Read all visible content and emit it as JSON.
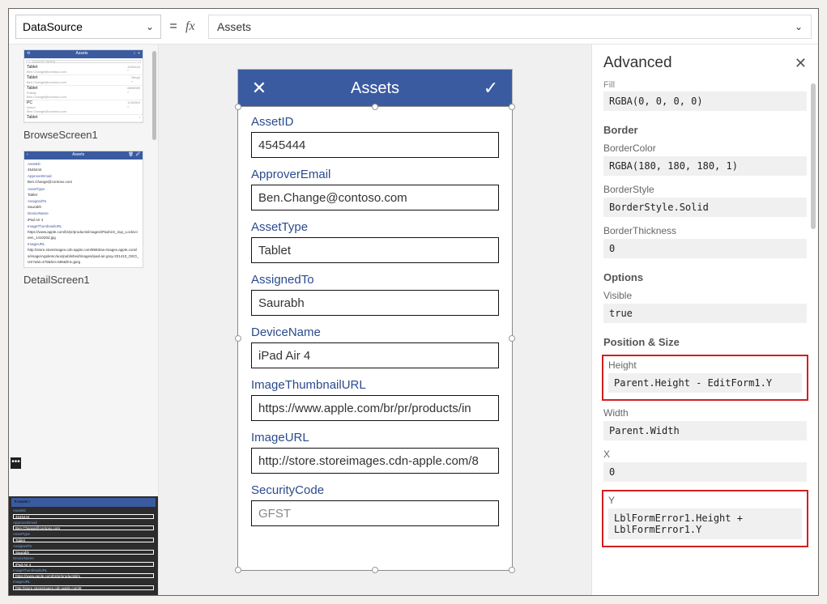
{
  "formulaBar": {
    "property": "DataSource",
    "formula": "Assets"
  },
  "tree": {
    "screen1Caption": "BrowseScreen1",
    "screen2Caption": "DetailScreen1",
    "browseHeader": "Assets",
    "rows": [
      {
        "title": "Tablet",
        "sub": "Ben.Change@contoso.com",
        "meta": "4545444"
      },
      {
        "title": "Tablet",
        "sub": "Ben.Change@contoso.com",
        "meta": "Bergh"
      },
      {
        "title": "Tablet",
        "sub": "Ben.Change@contoso.com",
        "meta": "8898989",
        "sub2": "Pratap"
      },
      {
        "title": "PC",
        "sub": "Ben.Change@contoso.com",
        "meta": "1234509",
        "sub2": "Aaron"
      },
      {
        "title": "Tablet",
        "sub": "",
        "meta": ""
      }
    ],
    "detailFields": [
      {
        "lbl": "AssetID",
        "val": "4545444"
      },
      {
        "lbl": "ApproverEmail",
        "val": "Ben.Change@contoso.com"
      },
      {
        "lbl": "AssetType",
        "val": "Tablet"
      },
      {
        "lbl": "AssignedTo",
        "val": "Saurabh"
      },
      {
        "lbl": "DeviceName",
        "val": "iPad Air 4"
      },
      {
        "lbl": "ImageThumbnailURL",
        "val": "https://www.apple.com/br/pr/products/images/iPadAir2_2up_Lockscreen_141020d.jpg"
      },
      {
        "lbl": "ImageURL",
        "val": "http://store.storeimages.cdn-apple.com/8583/as-images.apple.com/is/image/AppleInc/aos/published/images/ipad-air-gray-201410_GEO_US?wid=478&hei=595&fmt=jpeg"
      }
    ],
    "editFields": [
      {
        "lbl": "AssetID",
        "val": "4545444"
      },
      {
        "lbl": "ApproverEmail",
        "val": "Ben.Change@contoso.com"
      },
      {
        "lbl": "AssetType",
        "val": "Tablet"
      },
      {
        "lbl": "AssignedTo",
        "val": "Saurabh"
      },
      {
        "lbl": "DeviceName",
        "val": "iPad Air 4"
      },
      {
        "lbl": "ImageThumbnailURL",
        "val": "https://www.apple.com/br/pr/products/im"
      },
      {
        "lbl": "ImageURL",
        "val": "http://store.storeimages.cdn-apple.com/8"
      }
    ]
  },
  "form": {
    "title": "Assets",
    "fields": [
      {
        "label": "AssetID",
        "value": "4545444"
      },
      {
        "label": "ApproverEmail",
        "value": "Ben.Change@contoso.com"
      },
      {
        "label": "AssetType",
        "value": "Tablet"
      },
      {
        "label": "AssignedTo",
        "value": "Saurabh"
      },
      {
        "label": "DeviceName",
        "value": "iPad Air 4"
      },
      {
        "label": "ImageThumbnailURL",
        "value": "https://www.apple.com/br/pr/products/in"
      },
      {
        "label": "ImageURL",
        "value": "http://store.storeimages.cdn-apple.com/8"
      },
      {
        "label": "SecurityCode",
        "value": "GFST"
      }
    ]
  },
  "advanced": {
    "title": "Advanced",
    "fillLabel": "Fill",
    "fill": "RGBA(0, 0, 0, 0)",
    "borderSection": "Border",
    "borderColorLabel": "BorderColor",
    "borderColor": "RGBA(180, 180, 180, 1)",
    "borderStyleLabel": "BorderStyle",
    "borderStyle": "BorderStyle.Solid",
    "borderThicknessLabel": "BorderThickness",
    "borderThickness": "0",
    "optionsSection": "Options",
    "visibleLabel": "Visible",
    "visible": "true",
    "posSection": "Position & Size",
    "heightLabel": "Height",
    "height": "Parent.Height - EditForm1.Y",
    "widthLabel": "Width",
    "width": "Parent.Width",
    "xLabel": "X",
    "x": "0",
    "yLabel": "Y",
    "y": "LblFormError1.Height + LblFormError1.Y"
  }
}
